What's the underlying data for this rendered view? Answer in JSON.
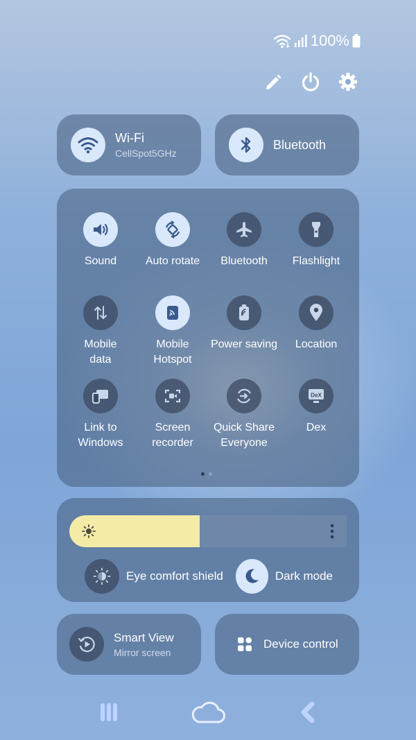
{
  "status_bar": {
    "battery_text": "100%"
  },
  "header_actions": [
    {
      "name": "edit-icon"
    },
    {
      "name": "power-icon"
    },
    {
      "name": "settings-icon"
    }
  ],
  "tiles": {
    "wifi": {
      "title": "Wi-Fi",
      "subtitle": "CellSpot5GHz"
    },
    "bluetooth": {
      "title": "Bluetooth"
    }
  },
  "quick_settings": [
    {
      "label": "Sound",
      "icon": "sound-icon",
      "active": true
    },
    {
      "label": "Auto rotate",
      "icon": "auto-rotate-icon",
      "active": true
    },
    {
      "label": "Bluetooth",
      "icon": "airplane-icon",
      "active": false
    },
    {
      "label": "Flashlight",
      "icon": "flashlight-icon",
      "active": false
    },
    {
      "label": "Mobile\ndata",
      "icon": "mobile-data-icon",
      "active": false
    },
    {
      "label": "Mobile\nHotspot",
      "icon": "hotspot-icon",
      "active": true
    },
    {
      "label": "Power saving",
      "icon": "power-saving-icon",
      "active": false
    },
    {
      "label": "Location",
      "icon": "location-icon",
      "active": false
    },
    {
      "label": "Link to\nWindows",
      "icon": "link-to-windows-icon",
      "active": false
    },
    {
      "label": "Screen\nrecorder",
      "icon": "screen-recorder-icon",
      "active": false
    },
    {
      "label": "Quick Share\nEveryone",
      "icon": "quick-share-icon",
      "active": false
    },
    {
      "label": "Dex",
      "icon": "dex-icon",
      "active": false
    }
  ],
  "page_indicator": {
    "pages": 2,
    "current": 1
  },
  "brightness": {
    "level": 0.47
  },
  "toggles": {
    "eye_comfort": {
      "label": "Eye comfort shield",
      "active": false
    },
    "dark_mode": {
      "label": "Dark mode",
      "active": true
    }
  },
  "bottom_tiles": {
    "smart_view": {
      "title": "Smart View",
      "subtitle": "Mirror screen"
    },
    "device_control": {
      "title": "Device control"
    }
  },
  "nav": [
    {
      "name": "recent-apps-icon"
    },
    {
      "name": "home-cloud-icon"
    },
    {
      "name": "back-icon"
    }
  ],
  "colors": {
    "active_circle": "#d9e8fb",
    "active_icon": "#3a5a8c",
    "inactive_circle": "#3c4a62",
    "brightness_fill": "#f4eba7",
    "nav_icon": "#bcd4ff"
  }
}
